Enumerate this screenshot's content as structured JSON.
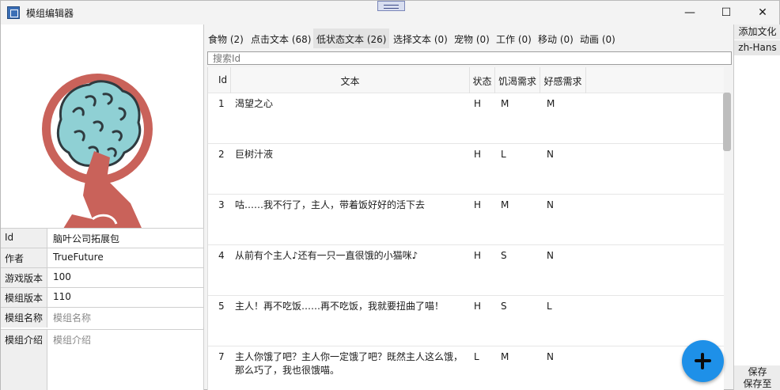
{
  "window": {
    "title": "模组编辑器",
    "minimize": "—",
    "maximize": "☐",
    "close": "✕"
  },
  "brand_colors": {
    "logo_ring": "#c9625a",
    "logo_brain": "#8fd0d4",
    "fab": "#1e90e8"
  },
  "properties": {
    "id_label": "Id",
    "id_value": "脑叶公司拓展包",
    "author_label": "作者",
    "author_value": "TrueFuture",
    "game_version_label": "游戏版本",
    "game_version_value": "100",
    "mod_version_label": "模组版本",
    "mod_version_value": "110",
    "mod_name_label": "模组名称",
    "mod_name_placeholder": "模组名称",
    "mod_desc_label": "模组介绍",
    "mod_desc_placeholder": "模组介绍"
  },
  "tabs": [
    {
      "label": "食物 (2)"
    },
    {
      "label": "点击文本 (68)"
    },
    {
      "label": "低状态文本 (26)",
      "active": true
    },
    {
      "label": "选择文本 (0)"
    },
    {
      "label": "宠物 (0)"
    },
    {
      "label": "工作 (0)"
    },
    {
      "label": "移动 (0)"
    },
    {
      "label": "动画 (0)"
    }
  ],
  "search": {
    "placeholder": "搜索Id"
  },
  "grid": {
    "headers": {
      "id": "Id",
      "text": "文本",
      "state": "状态",
      "hunger": "饥渴需求",
      "favor": "好感需求"
    },
    "rows": [
      {
        "id": "1",
        "text": "渴望之心",
        "state": "H",
        "hunger": "M",
        "favor": "M"
      },
      {
        "id": "2",
        "text": "巨树汁液",
        "state": "H",
        "hunger": "L",
        "favor": "N"
      },
      {
        "id": "3",
        "text": "咕……我不行了，主人，带着饭好好的活下去",
        "state": "H",
        "hunger": "M",
        "favor": "N"
      },
      {
        "id": "4",
        "text": "从前有个主人♪还有一只一直很饿的小猫咪♪",
        "state": "H",
        "hunger": "S",
        "favor": "N"
      },
      {
        "id": "5",
        "text": "主人！再不吃饭……再不吃饭，我就要扭曲了喵！",
        "state": "H",
        "hunger": "S",
        "favor": "L"
      },
      {
        "id": "7",
        "text": "主人你饿了吧？主人你一定饿了吧？既然主人这么饿，",
        "text2": "那么巧了，我也很饿喵。",
        "state": "L",
        "hunger": "M",
        "favor": "N"
      }
    ]
  },
  "right_panel": {
    "add_culture": "添加文化",
    "culture_item": "zh-Hans",
    "save": "保存",
    "save_as": "保存至"
  },
  "fab": {
    "icon": "plus-icon"
  }
}
